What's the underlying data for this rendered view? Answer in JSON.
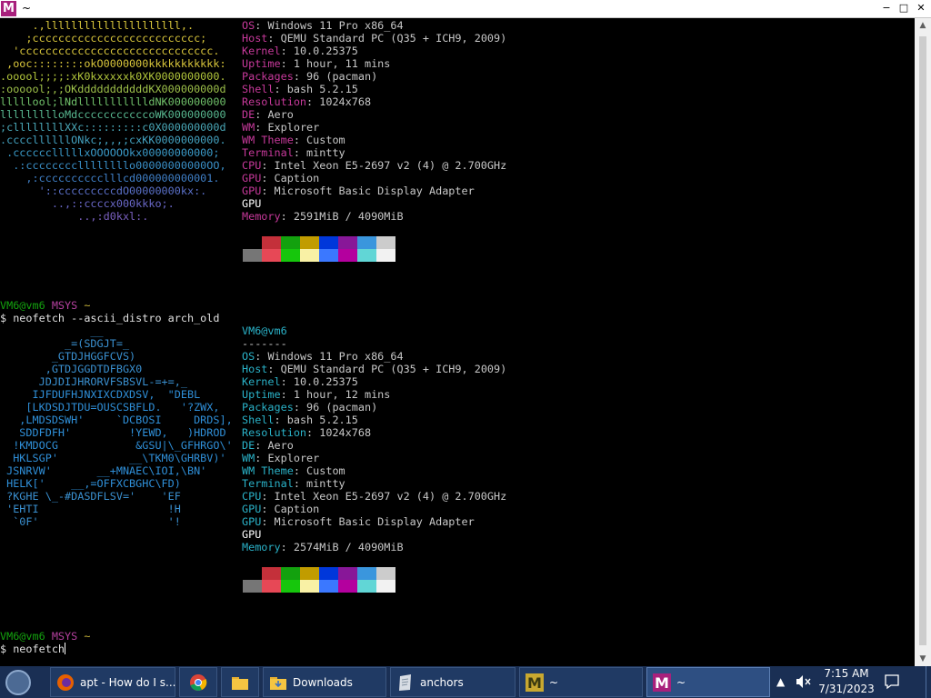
{
  "window": {
    "title": "~",
    "app_icon": "M",
    "minimize": "−",
    "maximize": "□",
    "close": "✕"
  },
  "colors": {
    "label_magenta": "#c6399a",
    "label_cyan": "#2ab2c8",
    "text": "#c8c8c8",
    "taskbar": "#1a2f54"
  },
  "ascii_art_1": [
    {
      "text": "     .,lllllllllllllllllllll,.",
      "color": "#d9c63b"
    },
    {
      "text": "    ;cccccccccccccccccccccccccc;",
      "color": "#d9c63b"
    },
    {
      "text": "  'cccccccccccccccccccccccccccccc.",
      "color": "#d9c63b"
    },
    {
      "text": " ,ooc::::::::okO0000000kkkkkkkkkkk:",
      "color": "#d9c63b"
    },
    {
      "text": ".ooool;;;;:xK0kxxxxxk0XK0000000000.",
      "color": "#b2c63b"
    },
    {
      "text": ":oooool;,;OKdddddddddddKX000000000d",
      "color": "#9ec14a"
    },
    {
      "text": "lllllool;lNdllllllllllldNK000000000",
      "color": "#70c16a"
    },
    {
      "text": "llllllllloMdcccccccccccoWK000000000",
      "color": "#58b890"
    },
    {
      "text": ";cllllllllXXc:::::::::c0X000000000d",
      "color": "#4aa8b8"
    },
    {
      "text": ".ccccllllllONkc;,,,;cxKK0000000000.",
      "color": "#44a2c0"
    },
    {
      "text": " .cccccclllllxOOOOOOkx00000000000;",
      "color": "#3a9ac8"
    },
    {
      "text": "  .:ccccccccllllllllo00000000000OO,",
      "color": "#3a90c8"
    },
    {
      "text": "    ,:cccccccccclllcd000000000001.",
      "color": "#4080c8"
    },
    {
      "text": "      '::cccccccccdO00000000kx:.",
      "color": "#5a70c8"
    },
    {
      "text": "        ..,::ccccx000kkko;.",
      "color": "#6a68c8"
    },
    {
      "text": "            ..,:d0kxl:.",
      "color": "#7a60c0"
    }
  ],
  "info_1": [
    {
      "label": "OS",
      "value": "Windows 11 Pro x86_64"
    },
    {
      "label": "Host",
      "value": "QEMU Standard PC (Q35 + ICH9, 2009)"
    },
    {
      "label": "Kernel",
      "value": "10.0.25375"
    },
    {
      "label": "Uptime",
      "value": "1 hour, 11 mins"
    },
    {
      "label": "Packages",
      "value": "96 (pacman)"
    },
    {
      "label": "Shell",
      "value": "bash 5.2.15"
    },
    {
      "label": "Resolution",
      "value": "1024x768"
    },
    {
      "label": "DE",
      "value": "Aero"
    },
    {
      "label": "WM",
      "value": "Explorer"
    },
    {
      "label": "WM Theme",
      "value": "Custom"
    },
    {
      "label": "Terminal",
      "value": "mintty"
    },
    {
      "label": "CPU",
      "value": "Intel Xeon E5-2697 v2 (4) @ 2.700GHz"
    },
    {
      "label": "GPU",
      "value": "Caption"
    },
    {
      "label": "GPU",
      "value": "Microsoft Basic Display Adapter"
    },
    {
      "label": "",
      "value": "GPU"
    },
    {
      "label": "Memory",
      "value": "2591MiB / 4090MiB"
    }
  ],
  "palette_top": [
    "#000000",
    "#c4303a",
    "#13a10e",
    "#c19c00",
    "#0037da",
    "#881798",
    "#3a96dd",
    "#cccccc"
  ],
  "palette_bottom": [
    "#767676",
    "#e74856",
    "#16c60c",
    "#f9f1a5",
    "#3b78ff",
    "#b4009e",
    "#61d6d6",
    "#f2f2f2"
  ],
  "prompt_1": {
    "user": "VM6@vm6",
    "system": "MSYS",
    "path": "~",
    "command": "$ neofetch --ascii_distro arch_old"
  },
  "ascii_art_2": [
    "              __",
    "          _=(SDGJT=_",
    "        _GTDJHGGFCVS)",
    "       ,GTDJGGDTDFBGX0",
    "      JDJDIJHRORVFSBSVL-=+=,_",
    "     IJFDUFHJNXIXCDXDSV,  \"DEBL",
    "    [LKDSDJTDU=OUSCSBFLD.   '?ZWX,",
    "   ,LMDSDSWH'     `DCBOSI     DRDS],",
    "   SDDFDFH'         !YEWD,   )HDROD",
    "  !KMDOCG            &GSU|\\_GFHRGO\\'",
    "  HKLSGP'           __\\TKM0\\GHRBV)'",
    " JSNRVW'       __+MNAEC\\IOI,\\BN'",
    " HELK['    __,=OFFXCBGHC\\FD)",
    " ?KGHE \\_-#DASDFLSV='    'EF",
    " 'EHTI                    !H",
    "  `0F'                    '!"
  ],
  "user_host_2": "VM6@vm6",
  "separator_2": "-------",
  "info_2": [
    {
      "label": "OS",
      "value": "Windows 11 Pro x86_64"
    },
    {
      "label": "Host",
      "value": "QEMU Standard PC (Q35 + ICH9, 2009)"
    },
    {
      "label": "Kernel",
      "value": "10.0.25375"
    },
    {
      "label": "Uptime",
      "value": "1 hour, 12 mins"
    },
    {
      "label": "Packages",
      "value": "96 (pacman)"
    },
    {
      "label": "Shell",
      "value": "bash 5.2.15"
    },
    {
      "label": "Resolution",
      "value": "1024x768"
    },
    {
      "label": "DE",
      "value": "Aero"
    },
    {
      "label": "WM",
      "value": "Explorer"
    },
    {
      "label": "WM Theme",
      "value": "Custom"
    },
    {
      "label": "Terminal",
      "value": "mintty"
    },
    {
      "label": "CPU",
      "value": "Intel Xeon E5-2697 v2 (4) @ 2.700GHz"
    },
    {
      "label": "GPU",
      "value": "Caption"
    },
    {
      "label": "GPU",
      "value": "Microsoft Basic Display Adapter"
    },
    {
      "label": "",
      "value": "GPU"
    },
    {
      "label": "Memory",
      "value": "2574MiB / 4090MiB"
    }
  ],
  "prompt_2": {
    "user": "VM6@vm6",
    "system": "MSYS",
    "path": "~",
    "command": "$ neofetch"
  },
  "taskbar": {
    "items": [
      {
        "label": "apt - How do I s...",
        "icon": "firefox-icon"
      },
      {
        "label": "",
        "icon": "chrome-icon"
      },
      {
        "label": "",
        "icon": "folder-icon"
      },
      {
        "label": "Downloads",
        "icon": "folder-icon"
      },
      {
        "label": "anchors",
        "icon": "document-icon"
      },
      {
        "label": "~",
        "icon": "mintty-icon"
      },
      {
        "label": "~",
        "icon": "mintty-icon"
      }
    ],
    "time": "7:15 AM",
    "date": "7/31/2023"
  }
}
